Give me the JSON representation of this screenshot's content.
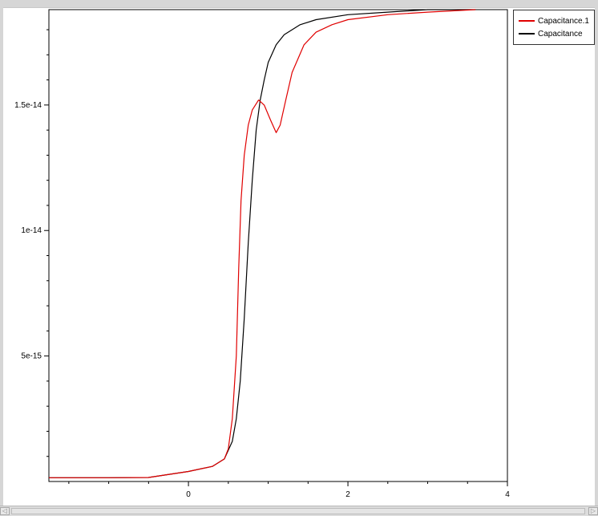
{
  "chart_data": {
    "type": "line",
    "title": "",
    "xlabel": "",
    "ylabel": "",
    "xlim": [
      -1.75,
      4
    ],
    "ylim": [
      0,
      1.88e-14
    ],
    "x_ticks": [
      {
        "value": 0,
        "label": "0"
      },
      {
        "value": 2,
        "label": "2"
      },
      {
        "value": 4,
        "label": "4"
      }
    ],
    "y_ticks": [
      {
        "value": 5e-15,
        "label": "5e-15"
      },
      {
        "value": 1e-14,
        "label": "1e-14"
      },
      {
        "value": 1.5e-14,
        "label": "1.5e-14"
      }
    ],
    "grid": false,
    "legend_position": "top-right outside",
    "series": [
      {
        "name": "Capacitance.1",
        "color": "#e00000",
        "points": [
          [
            -1.75,
            1.5e-16
          ],
          [
            -1.0,
            1.5e-16
          ],
          [
            -0.5,
            1.6e-16
          ],
          [
            0,
            4e-16
          ],
          [
            0.3,
            6e-16
          ],
          [
            0.45,
            9e-16
          ],
          [
            0.5,
            1.3e-15
          ],
          [
            0.55,
            2.5e-15
          ],
          [
            0.6,
            5e-15
          ],
          [
            0.63,
            8.5e-15
          ],
          [
            0.66,
            1.12e-14
          ],
          [
            0.7,
            1.3e-14
          ],
          [
            0.75,
            1.42e-14
          ],
          [
            0.8,
            1.48e-14
          ],
          [
            0.88,
            1.52e-14
          ],
          [
            0.95,
            1.5e-14
          ],
          [
            1.03,
            1.44e-14
          ],
          [
            1.1,
            1.39e-14
          ],
          [
            1.15,
            1.42e-14
          ],
          [
            1.22,
            1.52e-14
          ],
          [
            1.3,
            1.63e-14
          ],
          [
            1.45,
            1.74e-14
          ],
          [
            1.6,
            1.79e-14
          ],
          [
            1.8,
            1.82e-14
          ],
          [
            2.0,
            1.84e-14
          ],
          [
            2.5,
            1.86e-14
          ],
          [
            3.0,
            1.87e-14
          ],
          [
            3.6,
            1.88e-14
          ]
        ]
      },
      {
        "name": "Capacitance",
        "color": "#000000",
        "points": [
          [
            -1.75,
            1.5e-16
          ],
          [
            -1.0,
            1.5e-16
          ],
          [
            -0.5,
            1.6e-16
          ],
          [
            0,
            4e-16
          ],
          [
            0.3,
            6e-16
          ],
          [
            0.45,
            9e-16
          ],
          [
            0.55,
            1.6e-15
          ],
          [
            0.6,
            2.5e-15
          ],
          [
            0.65,
            4e-15
          ],
          [
            0.7,
            6.5e-15
          ],
          [
            0.75,
            9.5e-15
          ],
          [
            0.8,
            1.2e-14
          ],
          [
            0.85,
            1.4e-14
          ],
          [
            0.9,
            1.52e-14
          ],
          [
            0.95,
            1.6e-14
          ],
          [
            1.0,
            1.67e-14
          ],
          [
            1.1,
            1.74e-14
          ],
          [
            1.2,
            1.78e-14
          ],
          [
            1.4,
            1.82e-14
          ],
          [
            1.6,
            1.84e-14
          ],
          [
            2.0,
            1.86e-14
          ],
          [
            2.5,
            1.87e-14
          ],
          [
            3.0,
            1.88e-14
          ],
          [
            3.6,
            1.88e-14
          ]
        ]
      }
    ]
  },
  "legend": {
    "items": [
      {
        "label": "Capacitance.1",
        "color": "#e00000"
      },
      {
        "label": "Capacitance",
        "color": "#000000"
      }
    ]
  },
  "scrollbar": {
    "left_arrow": "◁",
    "right_arrow": "▷"
  }
}
